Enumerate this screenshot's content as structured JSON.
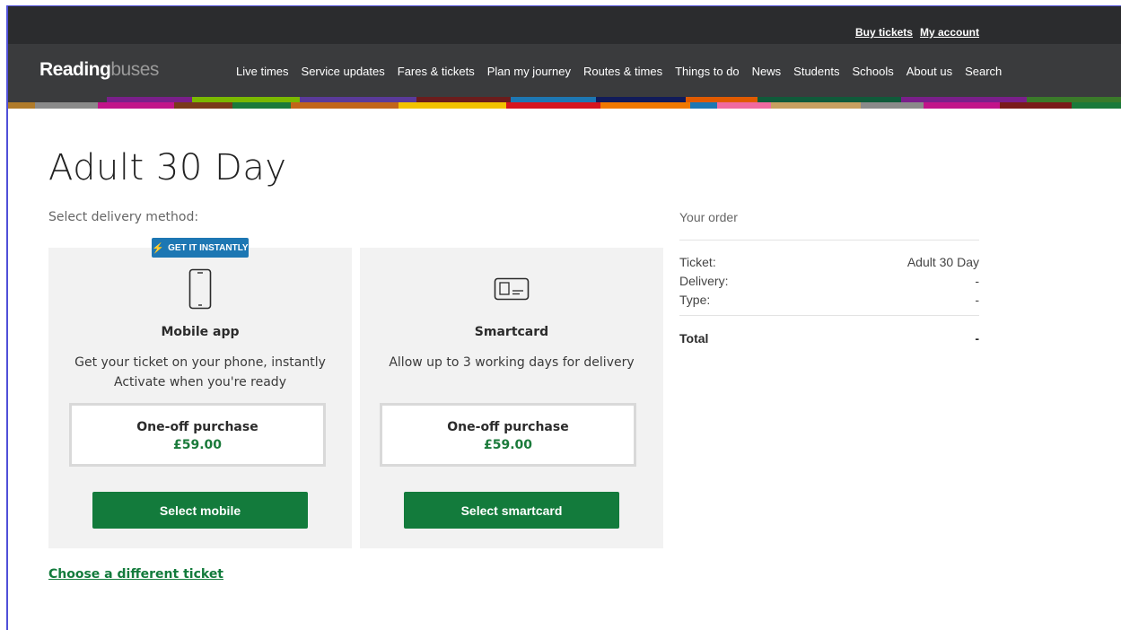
{
  "header": {
    "util_links": [
      "Buy tickets",
      "My account"
    ],
    "logo_primary": "Reading",
    "logo_secondary": "buses",
    "nav": [
      "Live times",
      "Service updates",
      "Fares & tickets",
      "Plan my journey",
      "Routes & times",
      "Things to do",
      "News",
      "Students",
      "Schools",
      "About us",
      "Search"
    ]
  },
  "page": {
    "title": "Adult 30 Day",
    "delivery_label": "Select delivery method:"
  },
  "mobile": {
    "badge": "GET IT INSTANTLY",
    "icon": "phone-icon",
    "title": "Mobile app",
    "desc1": "Get your ticket on your phone, instantly",
    "desc2": "Activate when you're ready",
    "price_label": "One-off purchase",
    "price": "£59.00",
    "button": "Select mobile"
  },
  "smartcard": {
    "icon": "smartcard-icon",
    "title": "Smartcard",
    "desc1": "Allow up to 3 working days for delivery",
    "price_label": "One-off purchase",
    "price": "£59.00",
    "button": "Select smartcard"
  },
  "different_ticket": "Choose a different ticket",
  "order": {
    "heading": "Your order",
    "ticket_label": "Ticket:",
    "ticket_value": "Adult 30 Day",
    "delivery_label": "Delivery:",
    "delivery_value": "-",
    "type_label": "Type:",
    "type_value": "-",
    "total_label": "Total",
    "total_value": "-"
  },
  "colors": {
    "brand_green": "#137b3c",
    "badge_blue": "#1d77b3",
    "header_dark": "#2b2c2e"
  }
}
